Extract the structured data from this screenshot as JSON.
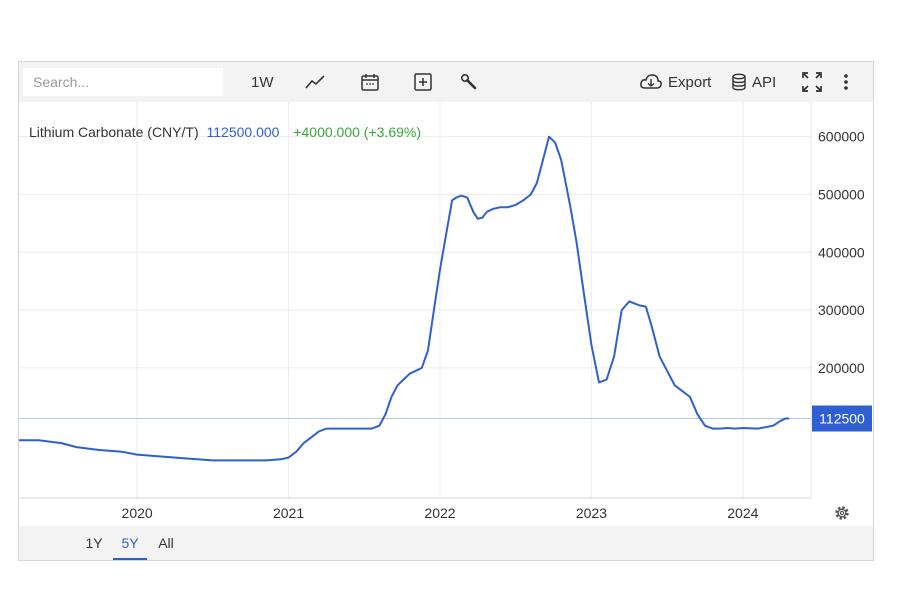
{
  "toolbar": {
    "search_placeholder": "Search...",
    "interval_label": "1W",
    "export_label": "Export",
    "api_label": "API",
    "icons": [
      "line-chart-icon",
      "calendar-icon",
      "plus-box-icon",
      "wrench-icon",
      "cloud-download-icon",
      "database-icon",
      "fullscreen-icon",
      "more-vertical-icon"
    ]
  },
  "legend": {
    "name": "Lithium Carbonate (CNY/T)",
    "last": "112500.000",
    "change": "+4000.000 (+3.69%)",
    "colors": {
      "name": "#333333",
      "last": "#2f5fd0",
      "change": "#3aa83a"
    }
  },
  "ranges": {
    "items": [
      "1Y",
      "5Y",
      "All"
    ],
    "active": "5Y"
  },
  "chart_data": {
    "type": "line",
    "title": "Lithium Carbonate (CNY/T)",
    "xlabel": "",
    "ylabel": "",
    "xlim": [
      2019.22,
      2024.45
    ],
    "ylim": [
      -25000,
      660000
    ],
    "yticks": [
      200000,
      300000,
      400000,
      500000,
      600000
    ],
    "yticklabels": [
      "200000",
      "300000",
      "400000",
      "500000",
      "600000"
    ],
    "xticks": [
      2020,
      2021,
      2022,
      2023,
      2024
    ],
    "xticklabels": [
      "2020",
      "2021",
      "2022",
      "2023",
      "2024"
    ],
    "grid": true,
    "current_value": 112500,
    "current_label": "112500",
    "line_color": "#2f5fd0",
    "series": [
      {
        "x": [
          2019.22,
          2019.35,
          2019.5,
          2019.6,
          2019.75,
          2019.9,
          2020.0,
          2020.2,
          2020.35,
          2020.5,
          2020.6,
          2020.75,
          2020.85,
          2020.95,
          2021.0,
          2021.05,
          2021.1,
          2021.15,
          2021.2,
          2021.25,
          2021.3,
          2021.35,
          2021.4,
          2021.45,
          2021.5,
          2021.55,
          2021.6,
          2021.64,
          2021.68,
          2021.72,
          2021.76,
          2021.8,
          2021.84,
          2021.88,
          2021.92,
          2021.96,
          2022.0,
          2022.04,
          2022.08,
          2022.11,
          2022.14,
          2022.18,
          2022.22,
          2022.25,
          2022.28,
          2022.31,
          2022.35,
          2022.4,
          2022.45,
          2022.5,
          2022.55,
          2022.6,
          2022.64,
          2022.68,
          2022.72,
          2022.76,
          2022.8,
          2022.83,
          2022.86,
          2022.9,
          2022.95,
          2023.0,
          2023.05,
          2023.1,
          2023.15,
          2023.2,
          2023.25,
          2023.28,
          2023.32,
          2023.36,
          2023.4,
          2023.45,
          2023.5,
          2023.55,
          2023.6,
          2023.65,
          2023.7,
          2023.75,
          2023.8,
          2023.85,
          2023.9,
          2023.95,
          2024.0,
          2024.1,
          2024.2,
          2024.25,
          2024.28,
          2024.3
        ],
        "y": [
          75000,
          75000,
          70000,
          63000,
          58000,
          55000,
          50000,
          46000,
          43000,
          40000,
          40000,
          40000,
          40000,
          42000,
          45000,
          55000,
          70000,
          80000,
          90000,
          95000,
          95000,
          95000,
          95000,
          95000,
          95000,
          95000,
          100000,
          120000,
          150000,
          170000,
          180000,
          190000,
          195000,
          200000,
          230000,
          300000,
          370000,
          430000,
          490000,
          495000,
          498000,
          495000,
          470000,
          458000,
          460000,
          470000,
          475000,
          478000,
          478000,
          482000,
          490000,
          500000,
          520000,
          560000,
          600000,
          590000,
          560000,
          520000,
          480000,
          420000,
          330000,
          240000,
          175000,
          180000,
          220000,
          300000,
          315000,
          312000,
          308000,
          306000,
          270000,
          220000,
          195000,
          170000,
          160000,
          150000,
          120000,
          100000,
          95000,
          95000,
          96000,
          95000,
          96000,
          95000,
          100000,
          108500,
          112500,
          112500
        ]
      }
    ]
  }
}
